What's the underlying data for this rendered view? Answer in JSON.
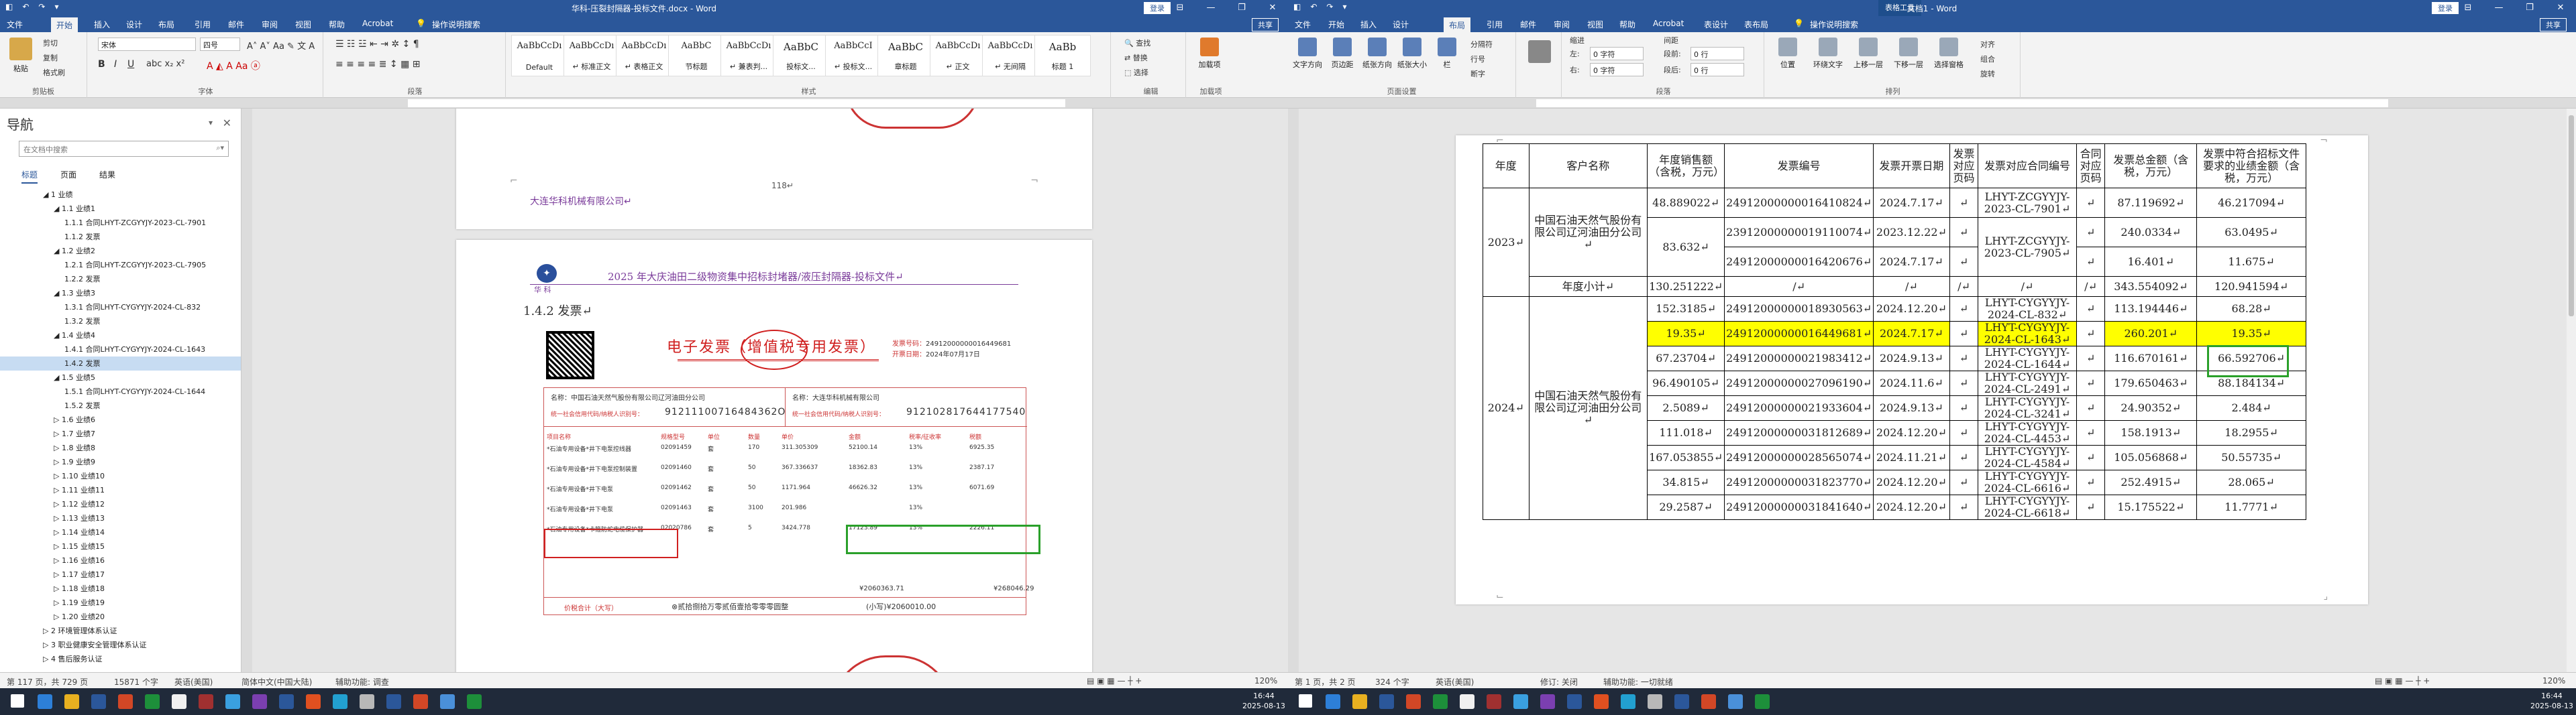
{
  "left": {
    "window_title": "华科-压裂封隔器-投标文件.docx - Word",
    "signin": "登录",
    "share": "共享",
    "tabs": [
      "文件",
      "开始",
      "插入",
      "设计",
      "布局",
      "引用",
      "邮件",
      "审阅",
      "视图",
      "帮助",
      "Acrobat"
    ],
    "active_tab": "开始",
    "tell_me": "操作说明搜索",
    "clipboard": {
      "paste": "粘贴",
      "cut": "剪切",
      "copy": "复制",
      "painter": "格式刷",
      "label": "剪贴板"
    },
    "font": {
      "name": "宋体",
      "size": "四号",
      "label": "字体"
    },
    "paragraph_label": "段落",
    "styles": [
      {
        "preview": "AaBbCcDı",
        "name": "Default"
      },
      {
        "preview": "AaBbCcDı",
        "name": "↵ 标准正文"
      },
      {
        "preview": "AaBbCcDı",
        "name": "↵ 表格正文"
      },
      {
        "preview": "AaBbC",
        "name": "节标题"
      },
      {
        "preview": "AaBbCcDı",
        "name": "↵ 兼表判..."
      },
      {
        "preview": "AaBbC",
        "name": "投标文..."
      },
      {
        "preview": "AaBbCcI",
        "name": "↵ 投标文..."
      },
      {
        "preview": "AaBbC",
        "name": "章标题"
      },
      {
        "preview": "AaBbCcDı",
        "name": "↵ 正文"
      },
      {
        "preview": "AaBbCcDı",
        "name": "↵ 无间隔"
      },
      {
        "preview": "AaBb",
        "name": "标题 1"
      }
    ],
    "styles_label": "样式",
    "editing": {
      "find": "查找",
      "replace": "替换",
      "select": "选择",
      "label": "编辑"
    },
    "addins": {
      "name": "加载项",
      "label": "加载项"
    },
    "nav": {
      "title": "导航",
      "search_placeholder": "在文档中搜索",
      "tabs": [
        "标题",
        "页面",
        "结果"
      ],
      "items": [
        {
          "level": 0,
          "text": "◢ 1 业绩",
          "state": "open"
        },
        {
          "level": 1,
          "text": "◢ 1.1 业绩1",
          "state": "open"
        },
        {
          "level": 2,
          "text": "1.1.1 合同LHYT-ZCGYYJY-2023-CL-7901",
          "state": "none"
        },
        {
          "level": 2,
          "text": "1.1.2 发票",
          "state": "none"
        },
        {
          "level": 1,
          "text": "◢ 1.2 业绩2",
          "state": "open"
        },
        {
          "level": 2,
          "text": "1.2.1 合同LHYT-ZCGYYJY-2023-CL-7905",
          "state": "none"
        },
        {
          "level": 2,
          "text": "1.2.2 发票",
          "state": "none"
        },
        {
          "level": 1,
          "text": "◢ 1.3 业绩3",
          "state": "open"
        },
        {
          "level": 2,
          "text": "1.3.1 合同LHYT-CYGYYJY-2024-CL-832",
          "state": "none"
        },
        {
          "level": 2,
          "text": "1.3.2 发票",
          "state": "none"
        },
        {
          "level": 1,
          "text": "◢ 1.4 业绩4",
          "state": "open"
        },
        {
          "level": 2,
          "text": "1.4.1 合同LHYT-CYGYYJY-2024-CL-1643",
          "state": "none"
        },
        {
          "level": 2,
          "text": "1.4.2 发票",
          "state": "selected"
        },
        {
          "level": 1,
          "text": "◢ 1.5 业绩5",
          "state": "open"
        },
        {
          "level": 2,
          "text": "1.5.1 合同LHYT-CYGYYJY-2024-CL-1644",
          "state": "none"
        },
        {
          "level": 2,
          "text": "1.5.2 发票",
          "state": "none"
        },
        {
          "level": 1,
          "text": "▷ 1.6 业绩6",
          "state": "closed"
        },
        {
          "level": 1,
          "text": "▷ 1.7 业绩7",
          "state": "closed"
        },
        {
          "level": 1,
          "text": "▷ 1.8 业绩8",
          "state": "closed"
        },
        {
          "level": 1,
          "text": "▷ 1.9 业绩9",
          "state": "closed"
        },
        {
          "level": 1,
          "text": "▷ 1.10 业绩10",
          "state": "closed"
        },
        {
          "level": 1,
          "text": "▷ 1.11 业绩11",
          "state": "closed"
        },
        {
          "level": 1,
          "text": "▷ 1.12 业绩12",
          "state": "closed"
        },
        {
          "level": 1,
          "text": "▷ 1.13 业绩13",
          "state": "closed"
        },
        {
          "level": 1,
          "text": "▷ 1.14 业绩14",
          "state": "closed"
        },
        {
          "level": 1,
          "text": "▷ 1.15 业绩15",
          "state": "closed"
        },
        {
          "level": 1,
          "text": "▷ 1.16 业绩16",
          "state": "closed"
        },
        {
          "level": 1,
          "text": "▷ 1.17 业绩17",
          "state": "closed"
        },
        {
          "level": 1,
          "text": "▷ 1.18 业绩18",
          "state": "closed"
        },
        {
          "level": 1,
          "text": "▷ 1.19 业绩19",
          "state": "closed"
        },
        {
          "level": 1,
          "text": "▷ 1.20 业绩20",
          "state": "closed"
        },
        {
          "level": 0,
          "text": "▷ 2 环境管理体系认证",
          "state": "closed"
        },
        {
          "level": 0,
          "text": "▷ 3 职业健康安全管理体系认证",
          "state": "closed"
        },
        {
          "level": 0,
          "text": "▷ 4 售后服务认证",
          "state": "closed"
        }
      ]
    },
    "page1": {
      "footer_company": "大连华科机械有限公司↵",
      "page_number": "118↵"
    },
    "page2": {
      "header_logo": "华  科",
      "header_text": "2025 年大庆油田二级物资集中招标封堵器/液压封隔器-投标文件↵",
      "heading": "1.4.2 发票↵",
      "invoice_title": "电子发票（增值税专用发票）",
      "invoice_no_label": "发票号码：",
      "invoice_no": "24912000000016449681",
      "invoice_date_label": "开票日期：",
      "invoice_date": "2024年07月17日",
      "buyer_name": "名称：中国石油天然气股份有限公司辽河油田分公司",
      "buyer_tax": "统一社会信用代码/纳税人识别号：",
      "buyer_tax_no": "91211100716484362O",
      "seller_name": "名称：大连华科机械有限公司",
      "seller_tax": "统一社会信用代码/纳税人识别号：",
      "seller_tax_no": "912102817644177540",
      "headers": [
        "项目名称",
        "规格型号",
        "单位",
        "数量",
        "单价",
        "金额",
        "税率/征收率",
        "税额"
      ],
      "rows": [
        [
          "*石油专用设备*井下电泵控线器",
          "02091459",
          "套",
          "170",
          "311.305309",
          "52100.14",
          "13%",
          "6925.35"
        ],
        [
          "*石油专用设备*井下电泵控制装置",
          "02091460",
          "套",
          "50",
          "367.336637",
          "18362.83",
          "13%",
          "2387.17"
        ],
        [
          "*石油专用设备*井下电泵",
          "02091462",
          "套",
          "50",
          "1171.964",
          "46626.32",
          "13%",
          "6071.69"
        ],
        [
          "*石油专用设备*井下电泵",
          "02091463",
          "套",
          "3100",
          "201.986",
          "",
          "13%",
          ""
        ],
        [
          "*石油专用设备*卡箍防蛇电缆保护器",
          "02020786",
          "套",
          "5",
          "3424.778",
          "17123.89",
          "13%",
          "2226.11"
        ]
      ],
      "total_amount": "¥2060363.71",
      "total_tax": "¥268046.29",
      "total_label": "价税合计（大写）",
      "total_words": "⊗贰拾捌拾万零贰佰壹拾零零零圆整",
      "total_small": "(小写)¥2060010.00"
    },
    "status": {
      "page": "第 117 页，共 729 页",
      "words": "15871 个字",
      "lang": "英语(美国)",
      "insert": "简体中文(中国大陆)",
      "access": "辅助功能: 调查",
      "zoom": "120%"
    }
  },
  "right": {
    "window_title": "文档1 - Word",
    "contextual_group": "表格工具",
    "signin": "登录",
    "share": "共享",
    "tabs": [
      "文件",
      "开始",
      "插入",
      "设计",
      "布局",
      "引用",
      "邮件",
      "审阅",
      "视图",
      "帮助",
      "Acrobat",
      "表设计",
      "表布局"
    ],
    "active_tab": "布局",
    "tell_me": "操作说明搜索",
    "page_setup": {
      "items": [
        "文字方向",
        "页边距",
        "纸张方向",
        "纸张大小",
        "栏"
      ],
      "side": [
        "分隔符",
        "行号",
        "断字"
      ],
      "label": "页面设置"
    },
    "paragraph": {
      "indent": "缩进",
      "spacing": "间距",
      "left_label": "左:",
      "left_val": "0 字符",
      "right_label": "右:",
      "right_val": "0 字符",
      "before_label": "段前:",
      "before_val": "0 行",
      "after_label": "段后:",
      "after_val": "0 行",
      "label": "段落"
    },
    "arrange": {
      "items": [
        "位置",
        "环绕文字",
        "上移一层",
        "下移一层",
        "选择窗格"
      ],
      "side": [
        "对齐",
        "组合",
        "旋转"
      ],
      "label": "排列"
    },
    "table": {
      "headers": [
        "年度",
        "客户名称",
        "年度销售额（含税，万元）",
        "发票编号",
        "发票开票日期",
        "发票对应页码",
        "发票对应合同编号",
        "合同对应页码",
        "发票总金额（含税，万元）",
        "发票中符合招标文件要求的业绩金额（含税，万元）"
      ],
      "group2023": {
        "year": "2023↵",
        "customer": "中国石油天然气股份有限公司辽河油田分公司↵",
        "rows": [
          [
            "48.889022↵",
            "24912000000016410824↵",
            "2024.7.17↵",
            "↵",
            "LHYT-ZCGYYJY-2023-CL-7901↵",
            "↵",
            "87.119692↵",
            "46.217094↵"
          ],
          [
            "83.632↵",
            "23912000000019110074↵",
            "2023.12.22↵",
            "↵",
            "LHYT-ZCGYYJY-2023-CL-7905↵",
            "↵",
            "240.0334↵",
            "63.0495↵"
          ],
          [
            "",
            "24912000000016420676↵",
            "2024.7.17↵",
            "↵",
            "",
            "↵",
            "16.401↵",
            "11.675↵"
          ]
        ],
        "subtotal": [
          "年度小计↵",
          "130.251222↵",
          "/↵",
          "/↵",
          "/↵",
          "/↵",
          "/↵",
          "343.554092↵",
          "120.941594↵"
        ]
      },
      "group2024": {
        "year": "2024↵",
        "customer": "中国石油天然气股份有限公司辽河油田分公司↵",
        "rows": [
          [
            "152.3185↵",
            "24912000000018930563↵",
            "2024.12.20↵",
            "↵",
            "LHYT-CYGYYJY-2024-CL-832↵",
            "↵",
            "113.194446↵",
            "68.28↵"
          ],
          [
            "19.35↵",
            "24912000000016449681↵",
            "2024.7.17↵",
            "↵",
            "LHYT-CYGYYJY-2024-CL-1643↵",
            "↵",
            "260.201↵",
            "19.35↵"
          ],
          [
            "67.23704↵",
            "24912000000021983412↵",
            "2024.9.13↵",
            "↵",
            "LHYT-CYGYYJY-2024-CL-1644↵",
            "↵",
            "116.670161↵",
            "66.592706↵"
          ],
          [
            "96.490105↵",
            "24912000000027096190↵",
            "2024.11.6↵",
            "↵",
            "LHYT-CYGYYJY-2024-CL-2491↵",
            "↵",
            "179.650463↵",
            "88.184134↵"
          ],
          [
            "2.5089↵",
            "24912000000021933604↵",
            "2024.9.13↵",
            "↵",
            "LHYT-CYGYYJY-2024-CL-3241↵",
            "↵",
            "24.90352↵",
            "2.484↵"
          ],
          [
            "111.018↵",
            "24912000000031812689↵",
            "2024.12.20↵",
            "↵",
            "LHYT-CYGYYJY-2024-CL-4453↵",
            "↵",
            "158.1913↵",
            "18.2955↵"
          ],
          [
            "167.053855↵",
            "24912000000028565074↵",
            "2024.11.21↵",
            "↵",
            "LHYT-CYGYYJY-2024-CL-4584↵",
            "↵",
            "105.056868↵",
            "50.55735↵"
          ],
          [
            "34.815↵",
            "24912000000031823770↵",
            "2024.12.20↵",
            "↵",
            "LHYT-CYGYYJY-2024-CL-6616↵",
            "↵",
            "252.4915↵",
            "28.065↵"
          ],
          [
            "29.2587↵",
            "24912000000031841640↵",
            "2024.12.20↵",
            "↵",
            "LHYT-CYGYYJY-2024-CL-6618↵",
            "↵",
            "15.175522↵",
            "11.7771↵"
          ]
        ]
      }
    },
    "status": {
      "page": "第 1 页，共 2 页",
      "words": "324 个字",
      "lang": "英语(美国)",
      "insert": "修订: 关闭",
      "access": "辅助功能: 一切就绪",
      "zoom": "120%"
    }
  },
  "taskbar": {
    "time": "16:44",
    "date": "2025-08-13"
  }
}
